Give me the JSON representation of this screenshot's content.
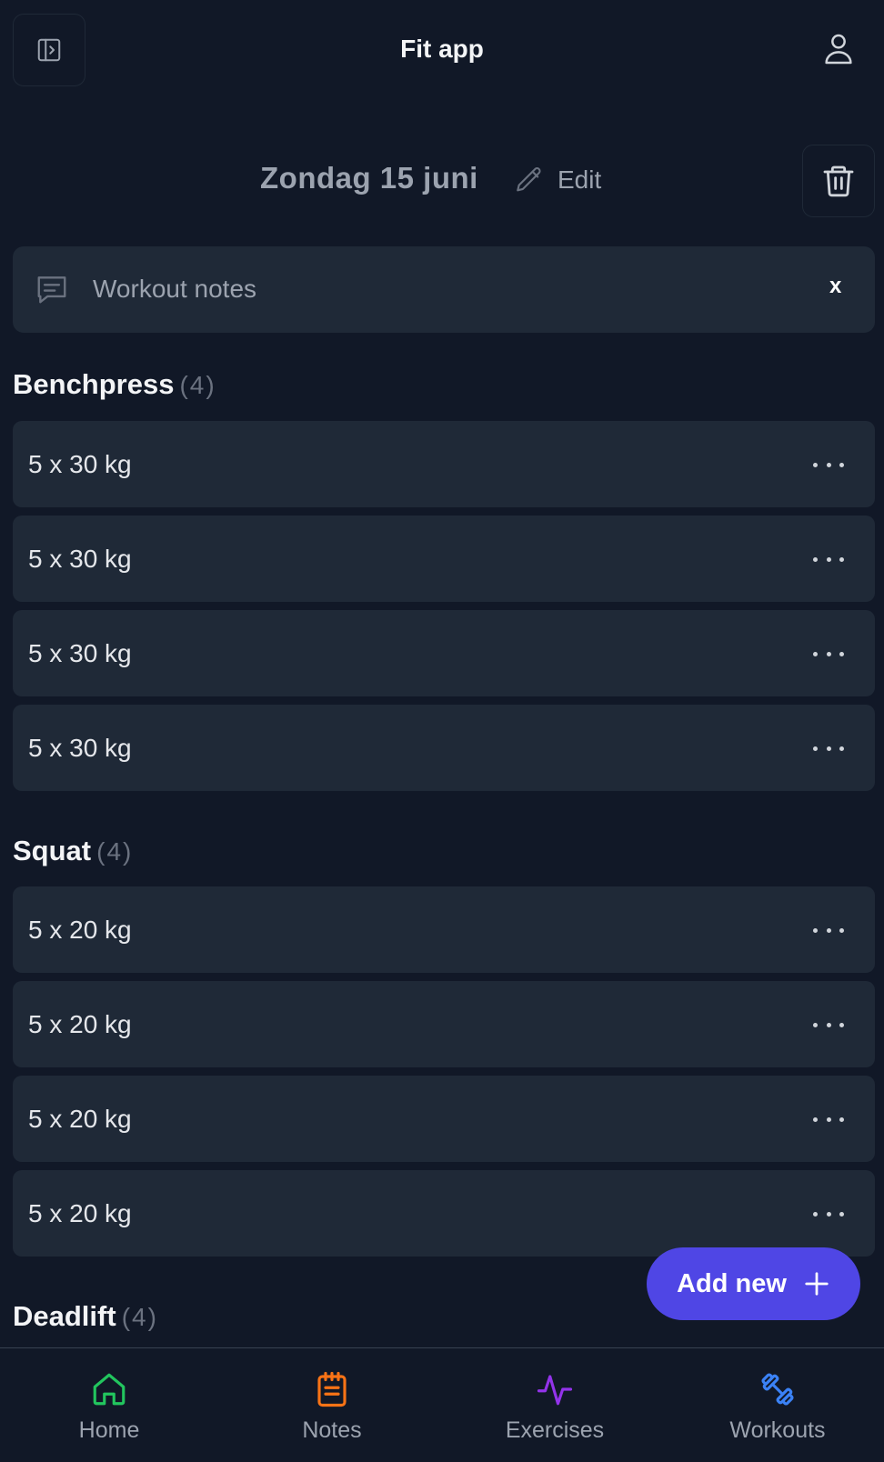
{
  "header": {
    "title": "Fit app",
    "sidebar_toggle_icon": "sidebar-panel-icon",
    "user_icon": "user-icon"
  },
  "workout": {
    "date": "Zondag 15 juni",
    "edit_label": "Edit",
    "delete_icon": "trash-icon"
  },
  "notes": {
    "placeholder": "Workout notes",
    "value": "",
    "close_label": "x"
  },
  "exercises": [
    {
      "name": "Benchpress",
      "count": "(4)",
      "sets": [
        "5 x 30 kg",
        "5 x 30 kg",
        "5 x 30 kg",
        "5 x 30 kg"
      ]
    },
    {
      "name": "Squat",
      "count": "(4)",
      "sets": [
        "5 x 20 kg",
        "5 x 20 kg",
        "5 x 20 kg",
        "5 x 20 kg"
      ]
    },
    {
      "name": "Deadlift",
      "count": "(4)",
      "sets": []
    }
  ],
  "add_button": {
    "label": "Add new",
    "icon": "plus-icon"
  },
  "bottom_nav": {
    "items": [
      {
        "label": "Home",
        "icon": "home-icon",
        "color": "#22c55e"
      },
      {
        "label": "Notes",
        "icon": "notepad-icon",
        "color": "#f97316"
      },
      {
        "label": "Exercises",
        "icon": "activity-icon",
        "color": "#9333ea"
      },
      {
        "label": "Workouts",
        "icon": "dumbbell-icon",
        "color": "#3b82f6"
      }
    ]
  },
  "colors": {
    "background": "#111827",
    "card": "#1f2937",
    "accent": "#4f46e5"
  }
}
